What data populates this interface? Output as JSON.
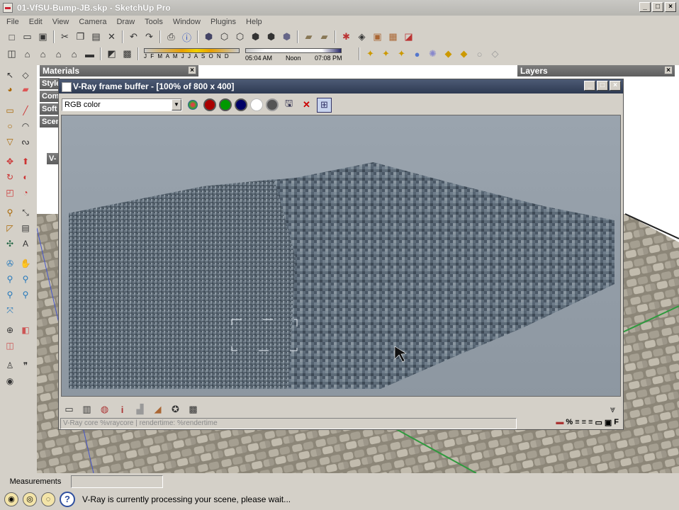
{
  "window": {
    "title": "01-VfSU-Bump-JB.skp - SketchUp Pro"
  },
  "menu": [
    "File",
    "Edit",
    "View",
    "Camera",
    "Draw",
    "Tools",
    "Window",
    "Plugins",
    "Help"
  ],
  "shadow": {
    "months": "J F M A M J J A S O N D",
    "time": "05:04 AM",
    "noon": "Noon",
    "end": "07:08 PM"
  },
  "panels": {
    "materials": "Materials",
    "layers": "Layers",
    "stubs": [
      "Style",
      "Com",
      "Soft",
      "Scen"
    ],
    "vstub": "V-"
  },
  "vfb": {
    "title": "V-Ray frame buffer - [100% of 800 x 400]",
    "channel": "RGB color",
    "status": "V-Ray core %vraycore | rendertime: %rendertime",
    "right_f": "F"
  },
  "measurements": {
    "label": "Measurements"
  },
  "statusbar": {
    "message": "V-Ray is currently processing your scene, please wait..."
  }
}
